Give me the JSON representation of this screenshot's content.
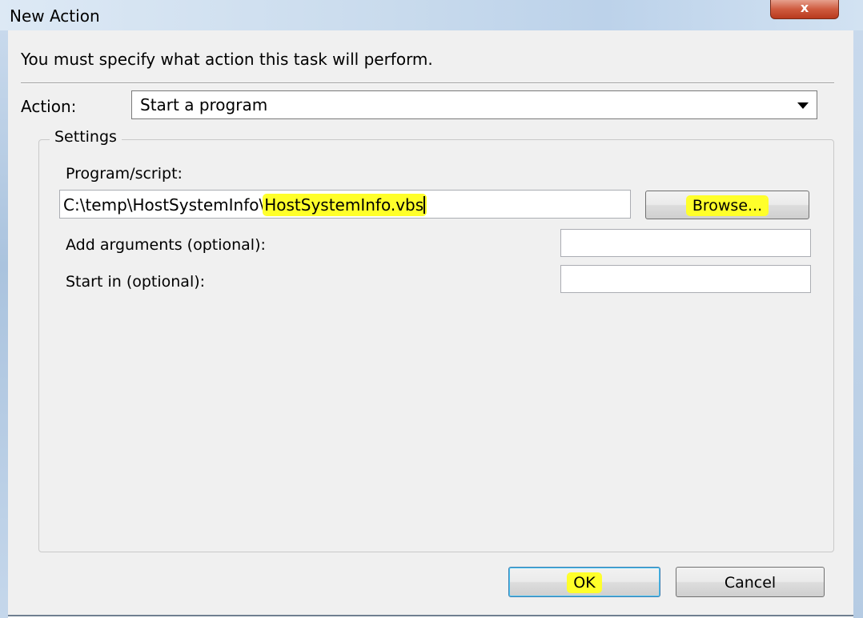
{
  "window": {
    "title": "New Action",
    "close_label": "x"
  },
  "instruction": "You must specify what action this task will perform.",
  "action": {
    "label": "Action:",
    "selected": "Start a program"
  },
  "settings": {
    "legend": "Settings",
    "program_label": "Program/script:",
    "program_value_prefix": "C:\\temp\\HostSystemInfo\\",
    "program_value_highlight": "HostSystemInfo.vbs",
    "browse_label": "Browse...",
    "arguments_label": "Add arguments (optional):",
    "arguments_value": "",
    "start_in_label": "Start in (optional):",
    "start_in_value": ""
  },
  "buttons": {
    "ok_label": "OK",
    "cancel_label": "Cancel"
  },
  "colors": {
    "highlight": "#ffff2a",
    "dialog_bg": "#f0f0f0",
    "close_button": "#c94a2e"
  }
}
